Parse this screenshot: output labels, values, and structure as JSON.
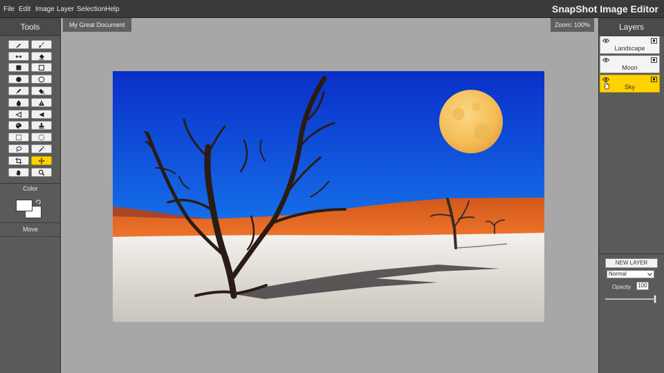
{
  "menubar": {
    "items": [
      "File",
      "Edit",
      "Image",
      "Layer",
      "Selection",
      "Help"
    ],
    "app_title": "SnapShot Image Editor"
  },
  "tools": {
    "title": "Tools",
    "buttons": [
      {
        "icon": "pencil-icon"
      },
      {
        "icon": "brush-icon"
      },
      {
        "icon": "line-icon"
      },
      {
        "icon": "eraser-icon"
      },
      {
        "icon": "filled-rectangle-icon"
      },
      {
        "icon": "rectangle-icon"
      },
      {
        "icon": "filled-ellipse-icon"
      },
      {
        "icon": "ellipse-icon"
      },
      {
        "icon": "eyedropper-icon"
      },
      {
        "icon": "paint-bucket-icon"
      },
      {
        "icon": "blur-drop-icon"
      },
      {
        "icon": "sharpen-icon"
      },
      {
        "icon": "dodge-icon"
      },
      {
        "icon": "burn-icon"
      },
      {
        "icon": "palette-icon"
      },
      {
        "icon": "stamp-icon"
      },
      {
        "icon": "rect-select-icon"
      },
      {
        "icon": "ellipse-select-icon"
      },
      {
        "icon": "lasso-icon"
      },
      {
        "icon": "magic-wand-icon"
      },
      {
        "icon": "crop-icon"
      },
      {
        "icon": "move-icon",
        "active": true
      },
      {
        "icon": "hand-icon"
      },
      {
        "icon": "zoom-icon"
      }
    ],
    "color_label": "Color",
    "current_tool_label": "Move"
  },
  "colors": {
    "foreground": "#ffffff",
    "background": "#ffffff",
    "accent": "#ffd200",
    "panel": "#5a5a5a",
    "workspace": "#a7a7a7"
  },
  "document": {
    "tab_title": "My Great Document",
    "zoom": "Zoom: 100%"
  },
  "layers": {
    "title": "Layers",
    "items": [
      {
        "name": "Landscape",
        "active": false
      },
      {
        "name": "Moon",
        "active": false
      },
      {
        "name": "Sky",
        "active": true
      }
    ],
    "new_layer_label": "NEW LAYER",
    "blend_mode": "Normal",
    "opacity_label": "Opacity",
    "opacity_value": "100"
  }
}
